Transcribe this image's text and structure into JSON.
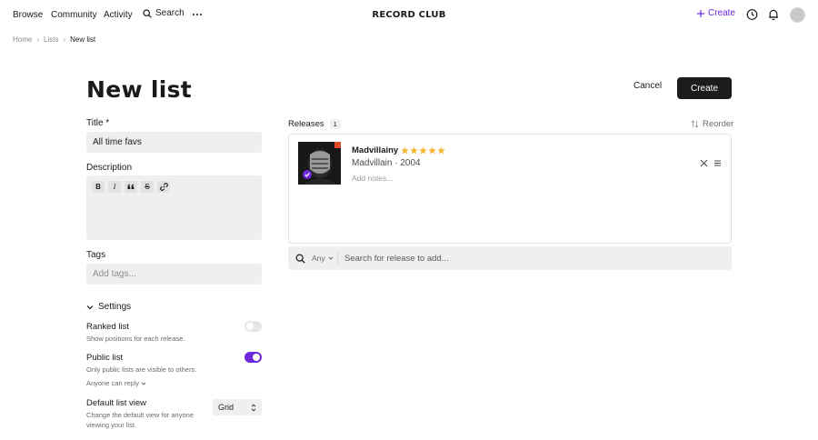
{
  "nav": {
    "browse": "Browse",
    "community": "Community",
    "activity": "Activity",
    "search": "Search",
    "brand": "RECORD CLUB",
    "create": "Create"
  },
  "breadcrumb": [
    "Home",
    "Lists",
    "New list"
  ],
  "page": {
    "title": "New list",
    "cancel": "Cancel",
    "create": "Create"
  },
  "form": {
    "title_label": "Title *",
    "title_value": "All time favs",
    "description_label": "Description",
    "format_buttons": [
      "B",
      "I",
      "❝",
      "S",
      "🔗"
    ],
    "tags_label": "Tags",
    "tags_placeholder": "Add tags..."
  },
  "settings": {
    "heading": "Settings",
    "ranked": {
      "title": "Ranked list",
      "desc": "Show positions for each release.",
      "enabled": false
    },
    "public": {
      "title": "Public list",
      "desc": "Only public lists are visible to others.",
      "enabled": true
    },
    "reply": "Anyone can reply",
    "default_view": {
      "title": "Default list view",
      "desc_line1": "Change the default view for anyone",
      "desc_line2": "viewing your list.",
      "value": "Grid"
    }
  },
  "releases": {
    "label": "Releases",
    "count": "1",
    "reorder": "Reorder",
    "items": [
      {
        "title": "Madvillainy",
        "rating": 5,
        "artist_year": "Madvillain · 2004",
        "notes_placeholder": "Add notes..."
      }
    ],
    "filter": "Any",
    "search_placeholder": "Search for release to add..."
  },
  "colors": {
    "accent": "#6d28d9",
    "star": "#f5b731",
    "button_dark": "#1c1c1c",
    "input_bg": "#efefef"
  }
}
